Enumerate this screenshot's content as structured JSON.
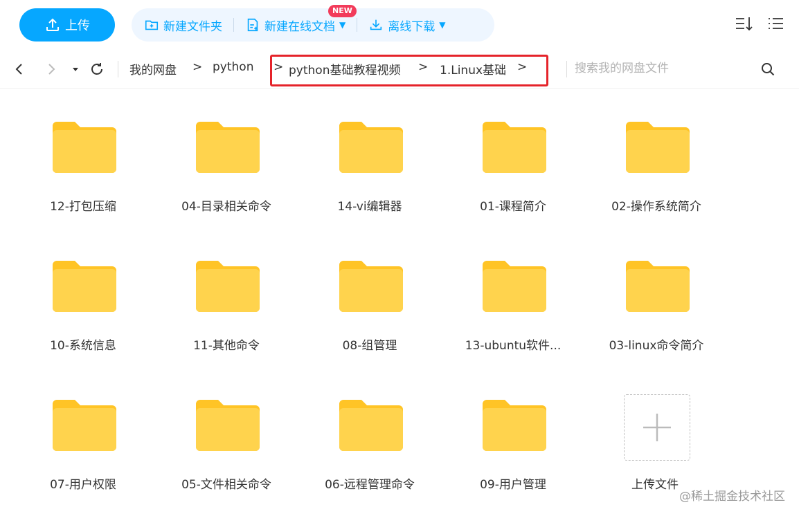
{
  "toolbar": {
    "upload_label": "上传",
    "new_folder_label": "新建文件夹",
    "new_online_doc_label": "新建在线文档",
    "new_badge": "NEW",
    "offline_download_label": "离线下载"
  },
  "nav": {
    "breadcrumb": [
      "我的网盘",
      "python",
      "python基础教程视频",
      "1.Linux基础"
    ],
    "separator": ">",
    "search_placeholder": "搜索我的网盘文件"
  },
  "folders": [
    "12-打包压缩",
    "04-目录相关命令",
    "14-vi编辑器",
    "01-课程简介",
    "02-操作系统简介",
    "10-系统信息",
    "11-其他命令",
    "08-组管理",
    "13-ubuntu软件...",
    "03-linux命令简介",
    "07-用户权限",
    "05-文件相关命令",
    "06-远程管理命令",
    "09-用户管理"
  ],
  "upload_tile": {
    "label": "上传文件"
  },
  "watermark": "@稀土掘金技术社区",
  "colors": {
    "accent": "#06a7ff",
    "folder": "#ffd34d",
    "folder_tab": "#ffc426",
    "highlight": "#e5232a",
    "badge": "#f23b5a"
  }
}
